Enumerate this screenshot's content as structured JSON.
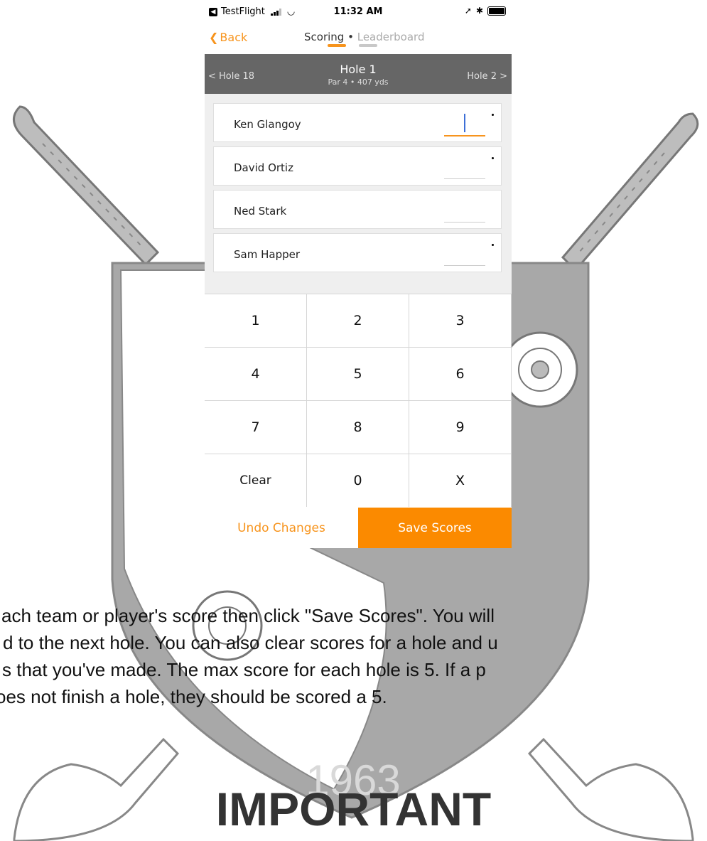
{
  "status_bar": {
    "app": "TestFlight",
    "time": "11:32 AM"
  },
  "nav": {
    "back_label": "Back",
    "tab_scoring": "Scoring",
    "tab_separator": "•",
    "tab_leaderboard": "Leaderboard"
  },
  "hole": {
    "prev": "< Hole 18",
    "title": "Hole 1",
    "subtitle": "Par 4 • 407 yds",
    "next": "Hole 2 >"
  },
  "players": [
    {
      "name": "Ken Glangoy",
      "score": "",
      "active": true,
      "dot": true
    },
    {
      "name": "David Ortiz",
      "score": "",
      "active": false,
      "dot": true
    },
    {
      "name": "Ned Stark",
      "score": "",
      "active": false,
      "dot": false
    },
    {
      "name": "Sam Happer",
      "score": "",
      "active": false,
      "dot": true
    }
  ],
  "keypad": [
    "1",
    "2",
    "3",
    "4",
    "5",
    "6",
    "7",
    "8",
    "9",
    "Clear",
    "0",
    "X"
  ],
  "actions": {
    "undo": "Undo Changes",
    "save": "Save Scores"
  },
  "instructions": [
    "ach team or player's score then click \"Save Scores\". You will",
    "d to the next hole. You can also clear scores for a hole and u",
    "s that you've made. The max score for each hole is 5.  If a p",
    "oes not finish a hole, they should be scored a 5."
  ],
  "heading": "IMPORTANT",
  "crest_year": "1963",
  "colors": {
    "accent": "#f7941d",
    "save_button": "#fb8a00",
    "hole_bar": "#666666",
    "crest": "#a9a9a9"
  }
}
